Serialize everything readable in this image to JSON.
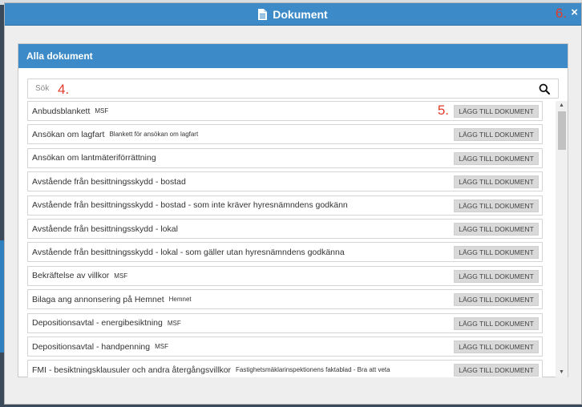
{
  "modal": {
    "title": "Dokument",
    "close_label": "×",
    "annotation_close": "6."
  },
  "panel": {
    "title": "Alla dokument"
  },
  "search": {
    "placeholder": "Sök",
    "annotation": "4."
  },
  "list": {
    "annotation_button": "5.",
    "button_label": "LÄGG TILL DOKUMENT",
    "items": [
      {
        "title": "Anbudsblankett",
        "tag": "MSF"
      },
      {
        "title": "Ansökan om lagfart",
        "tag": "Blankett för ansökan om lagfart"
      },
      {
        "title": "Ansökan om lantmäteriförrättning",
        "tag": ""
      },
      {
        "title": "Avstående från besittningsskydd - bostad",
        "tag": ""
      },
      {
        "title": "Avstående från besittningsskydd - bostad - som inte kräver hyresnämndens godkänn",
        "tag": ""
      },
      {
        "title": "Avstående från besittningsskydd - lokal",
        "tag": ""
      },
      {
        "title": "Avstående från besittningsskydd - lokal - som gäller utan hyresnämndens godkänna",
        "tag": ""
      },
      {
        "title": "Bekräftelse av villkor",
        "tag": "MSF"
      },
      {
        "title": "Bilaga ang annonsering på Hemnet",
        "tag": "Hemnet"
      },
      {
        "title": "Depositionsavtal - energibesiktning",
        "tag": "MSF"
      },
      {
        "title": "Depositionsavtal - handpenning",
        "tag": "MSF"
      },
      {
        "title": "FMI - besiktningsklausuler och andra återgångsvillkor",
        "tag": "Fastighetsmäklarinspektionens faktablad - Bra att veta"
      }
    ]
  },
  "colors": {
    "header_blue": "#3c8bc8",
    "annotation_red": "#e23b2b"
  }
}
